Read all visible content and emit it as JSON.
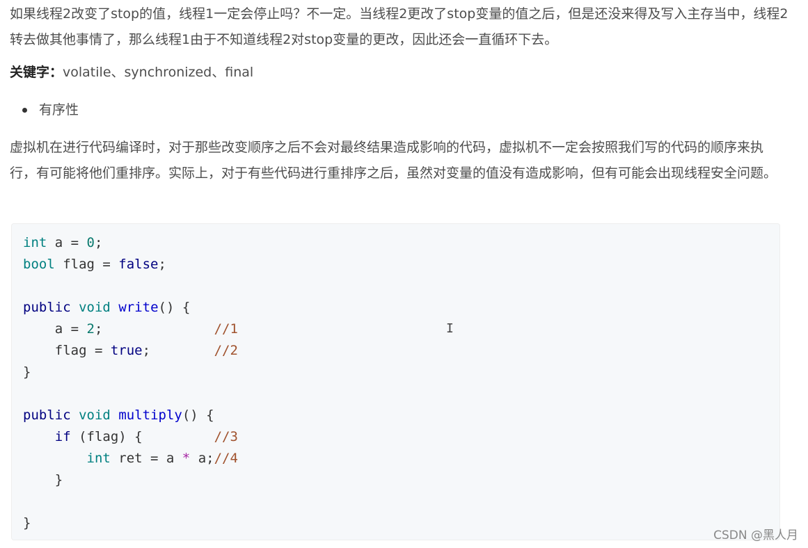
{
  "paragraph1": "如果线程2改变了stop的值，线程1一定会停止吗？不一定。当线程2更改了stop变量的值之后，但是还没来得及写入主存当中，线程2转去做其他事情了，那么线程1由于不知道线程2对stop变量的更改，因此还会一直循环下去。",
  "keywords": {
    "label": "关键字：",
    "text": "volatile、synchronized、final"
  },
  "bullet": "有序性",
  "paragraph2": "虚拟机在进行代码编译时，对于那些改变顺序之后不会对最终结果造成影响的代码，虚拟机不一定会按照我们写的代码的顺序来执行，有可能将他们重排序。实际上，对于有些代码进行重排序之后，虽然对变量的值没有造成影响，但有可能会出现线程安全问题。",
  "code": {
    "lines": [
      "int a = 0;",
      "bool flag = false;",
      "",
      "public void write() {",
      "    a = 2;              //1",
      "    flag = true;        //2",
      "}",
      "",
      "public void multiply() {",
      "    if (flag) {         //3",
      "        int ret = a * a;//4",
      "    }",
      "",
      "}"
    ]
  },
  "cursor_glyph": "I",
  "watermark": "CSDN @黑人月"
}
